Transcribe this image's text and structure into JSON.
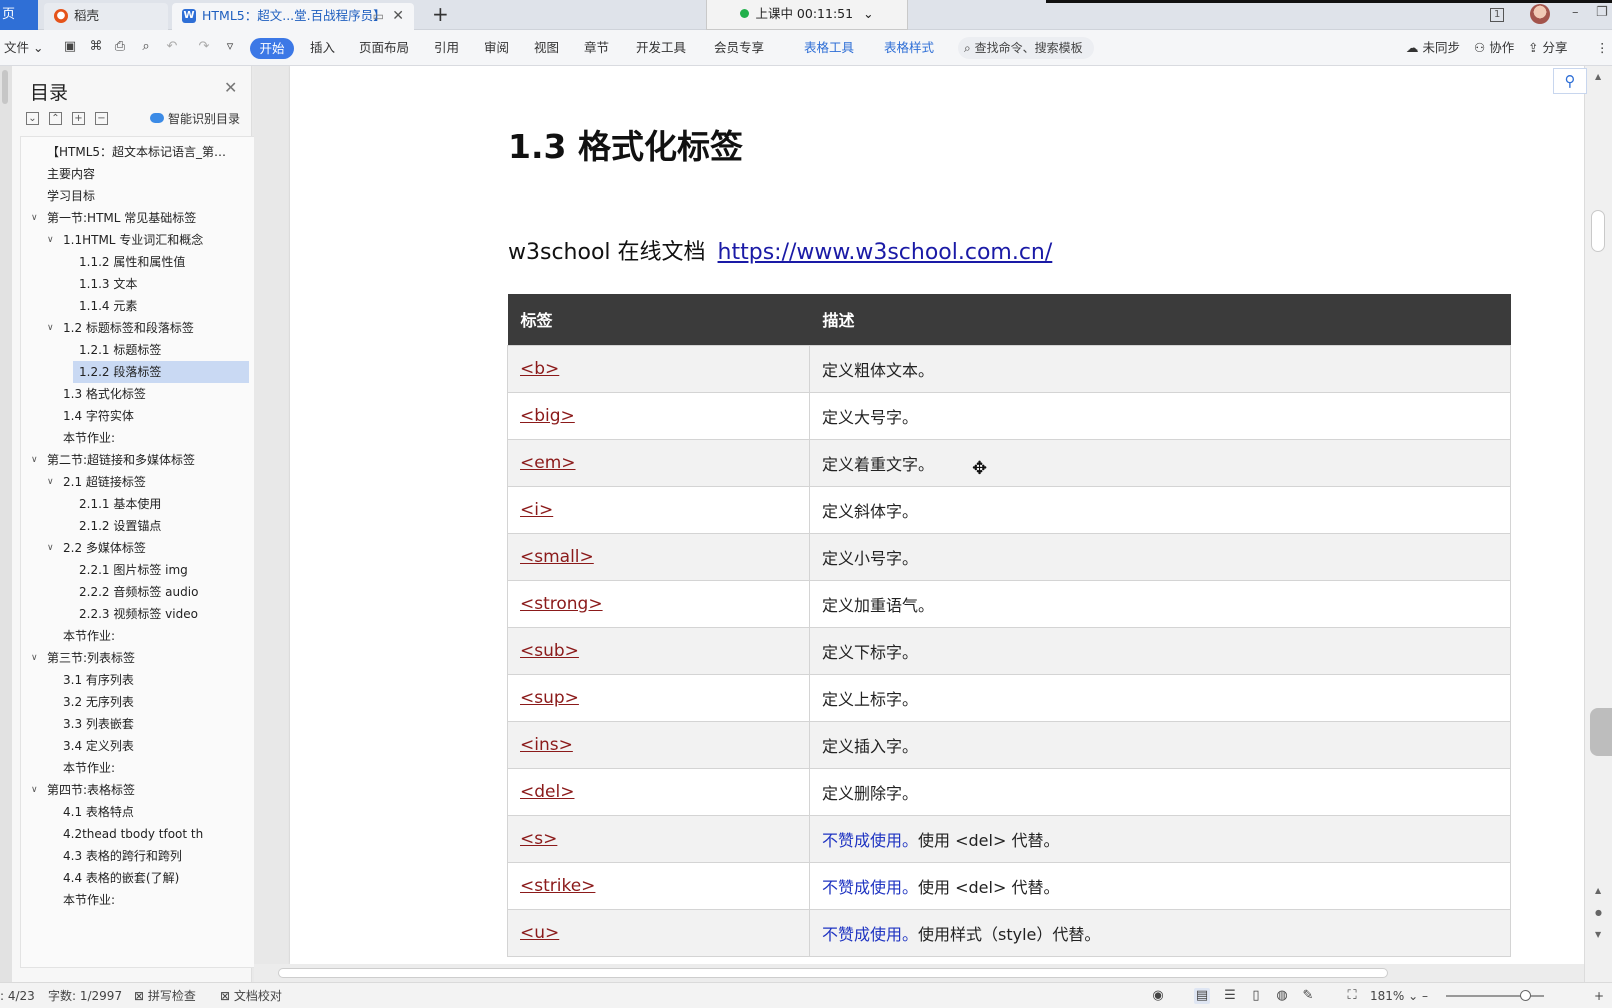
{
  "tabs": {
    "home_label": "页",
    "tab1_label": "稻壳",
    "tab2_label": "HTML5：超文...堂.百战程序员】",
    "new_tab": "+"
  },
  "timer": {
    "label": "上课中 00:11:51",
    "chevron": "⌄"
  },
  "window": {
    "badge": "1",
    "minimize": "–",
    "restore": "❐"
  },
  "ribbon": {
    "file": "文件",
    "tabs": [
      "开始",
      "插入",
      "页面布局",
      "引用",
      "审阅",
      "视图",
      "章节",
      "开发工具",
      "会员专享"
    ],
    "context_tabs": [
      "表格工具",
      "表格样式"
    ],
    "search_placeholder": "查找命令、搜索模板",
    "sync": "未同步",
    "collab": "协作",
    "share": "分享"
  },
  "toc": {
    "title": "目录",
    "smart": "智能识别目录",
    "items": [
      {
        "text": "【HTML5：超文本标记语言_第…",
        "level": 0,
        "chev": ""
      },
      {
        "text": "主要内容",
        "level": 0,
        "chev": ""
      },
      {
        "text": "学习目标",
        "level": 0,
        "chev": ""
      },
      {
        "text": "第一节:HTML 常见基础标签",
        "level": 0,
        "chev": "v"
      },
      {
        "text": "1.1HTML 专业词汇和概念",
        "level": 1,
        "chev": "v"
      },
      {
        "text": "1.1.2 属性和属性值",
        "level": 2,
        "chev": ""
      },
      {
        "text": "1.1.3 文本",
        "level": 2,
        "chev": ""
      },
      {
        "text": "1.1.4 元素",
        "level": 2,
        "chev": ""
      },
      {
        "text": "1.2 标题标签和段落标签",
        "level": 1,
        "chev": "v"
      },
      {
        "text": "1.2.1 标题标签",
        "level": 2,
        "chev": ""
      },
      {
        "text": "1.2.2 段落标签",
        "level": 2,
        "chev": "",
        "selected": true
      },
      {
        "text": "1.3 格式化标签",
        "level": 1,
        "chev": ""
      },
      {
        "text": "1.4 字符实体",
        "level": 1,
        "chev": ""
      },
      {
        "text": "本节作业:",
        "level": 1,
        "chev": ""
      },
      {
        "text": "第二节:超链接和多媒体标签",
        "level": 0,
        "chev": "v"
      },
      {
        "text": "2.1 超链接标签",
        "level": 1,
        "chev": "v"
      },
      {
        "text": "2.1.1 基本使用",
        "level": 2,
        "chev": ""
      },
      {
        "text": "2.1.2 设置锚点",
        "level": 2,
        "chev": ""
      },
      {
        "text": "2.2 多媒体标签",
        "level": 1,
        "chev": "v"
      },
      {
        "text": "2.2.1 图片标签 img",
        "level": 2,
        "chev": ""
      },
      {
        "text": "2.2.2 音频标签 audio",
        "level": 2,
        "chev": ""
      },
      {
        "text": "2.2.3 视频标签 video",
        "level": 2,
        "chev": ""
      },
      {
        "text": "本节作业:",
        "level": 1,
        "chev": ""
      },
      {
        "text": "第三节:列表标签",
        "level": 0,
        "chev": "v"
      },
      {
        "text": "3.1 有序列表",
        "level": 1,
        "chev": ""
      },
      {
        "text": "3.2 无序列表",
        "level": 1,
        "chev": ""
      },
      {
        "text": "3.3 列表嵌套",
        "level": 1,
        "chev": ""
      },
      {
        "text": "3.4 定义列表",
        "level": 1,
        "chev": ""
      },
      {
        "text": "本节作业:",
        "level": 1,
        "chev": ""
      },
      {
        "text": "第四节:表格标签",
        "level": 0,
        "chev": "v"
      },
      {
        "text": "4.1 表格特点",
        "level": 1,
        "chev": ""
      },
      {
        "text": "4.2thead tbody tfoot th",
        "level": 1,
        "chev": ""
      },
      {
        "text": "4.3 表格的跨行和跨列",
        "level": 1,
        "chev": ""
      },
      {
        "text": "4.4 表格的嵌套(了解)",
        "level": 1,
        "chev": ""
      },
      {
        "text": "本节作业:",
        "level": 1,
        "chev": ""
      }
    ]
  },
  "doc": {
    "heading": "1.3 格式化标签",
    "line_prefix": "w3school 在线文档",
    "link": "https://www.w3school.com.cn/",
    "table": {
      "headers": [
        "标签",
        "描述"
      ],
      "rows": [
        {
          "tag": "<b>",
          "warn": "",
          "desc": "定义粗体文本。"
        },
        {
          "tag": "<big>",
          "warn": "",
          "desc": "定义大号字。"
        },
        {
          "tag": "<em>",
          "warn": "",
          "desc": "定义着重文字。"
        },
        {
          "tag": "<i>",
          "warn": "",
          "desc": "定义斜体字。"
        },
        {
          "tag": "<small>",
          "warn": "",
          "desc": "定义小号字。"
        },
        {
          "tag": "<strong>",
          "warn": "",
          "desc": "定义加重语气。"
        },
        {
          "tag": "<sub>",
          "warn": "",
          "desc": "定义下标字。"
        },
        {
          "tag": "<sup>",
          "warn": "",
          "desc": "定义上标字。"
        },
        {
          "tag": "<ins>",
          "warn": "",
          "desc": "定义插入字。"
        },
        {
          "tag": "<del>",
          "warn": "",
          "desc": "定义删除字。"
        },
        {
          "tag": "<s>",
          "warn": "不赞成使用。",
          "desc": "使用 <del> 代替。"
        },
        {
          "tag": "<strike>",
          "warn": "不赞成使用。",
          "desc": "使用 <del> 代替。"
        },
        {
          "tag": "<u>",
          "warn": "不赞成使用。",
          "desc": "使用样式（style）代替。"
        }
      ]
    }
  },
  "status": {
    "page": ": 4/23",
    "words": "字数: 1/2997",
    "spell": "拼写检查",
    "proof": "文档校对",
    "zoom": "181%",
    "zoom_minus": "–",
    "zoom_plus": "+"
  },
  "colors": {
    "accent": "#3c78e6",
    "table_header": "#3b3b3b",
    "tag_link": "#8b1a1a",
    "deprecated": "#1f34c2",
    "selection": "#c9d9f3"
  }
}
